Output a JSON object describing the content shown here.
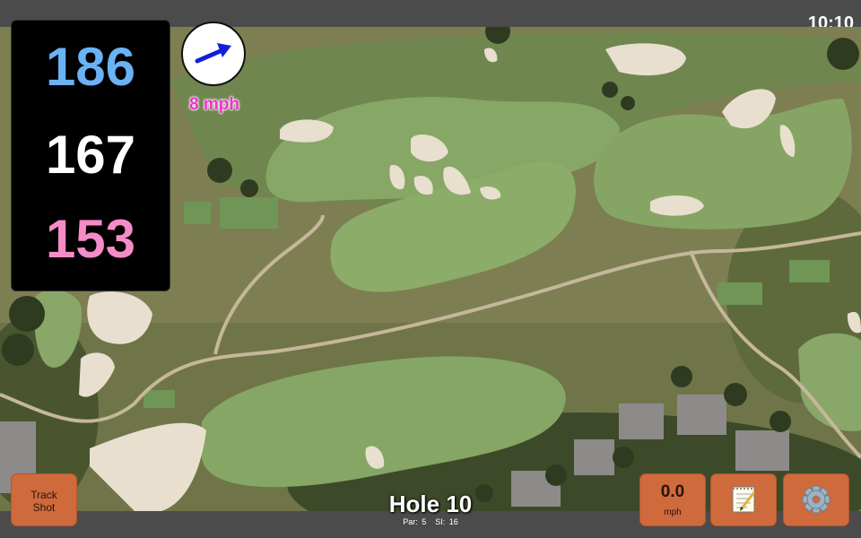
{
  "status_bar": {
    "time": "10:10"
  },
  "yardages": {
    "back": "186",
    "middle": "167",
    "front": "153"
  },
  "wind": {
    "speed_label": "8 mph",
    "arrow_icon": "arrow-right-icon"
  },
  "buttons": {
    "track_shot_line1": "Track",
    "track_shot_line2": "Shot",
    "wind_value": "0.0",
    "wind_unit": "mph",
    "notes_icon": "notepad-icon",
    "settings_icon": "gear-icon"
  },
  "hole": {
    "title": "Hole 10",
    "par_label": "Par: 5",
    "si_label": "SI: 16"
  },
  "colors": {
    "back_yardage": "#6ab2f4",
    "middle_yardage": "#ffffff",
    "front_yardage": "#f58cc8",
    "button": "#cf6a3d",
    "wind_text": "#ee33cc"
  }
}
